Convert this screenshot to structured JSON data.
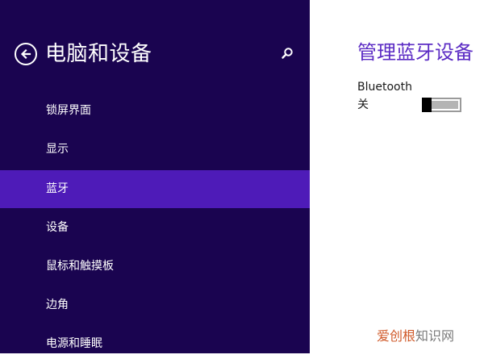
{
  "sidebar": {
    "title": "电脑和设备",
    "back_icon": "back-arrow-icon",
    "search_icon": "search-icon",
    "items": [
      {
        "label": "锁屏界面",
        "active": false
      },
      {
        "label": "显示",
        "active": false
      },
      {
        "label": "蓝牙",
        "active": true
      },
      {
        "label": "设备",
        "active": false
      },
      {
        "label": "鼠标和触摸板",
        "active": false
      },
      {
        "label": "边角",
        "active": false
      },
      {
        "label": "电源和睡眠",
        "active": false
      }
    ]
  },
  "content": {
    "title": "管理蓝牙设备",
    "bluetooth": {
      "label": "Bluetooth",
      "state": "关",
      "enabled": false
    }
  },
  "watermark": {
    "brand": "爱创根",
    "suffix": "知识网"
  },
  "colors": {
    "sidebar_bg": "#1a0450",
    "active_item_bg": "#4e1bb8",
    "accent": "#5b2bc4",
    "content_bg": "#ffffff"
  }
}
